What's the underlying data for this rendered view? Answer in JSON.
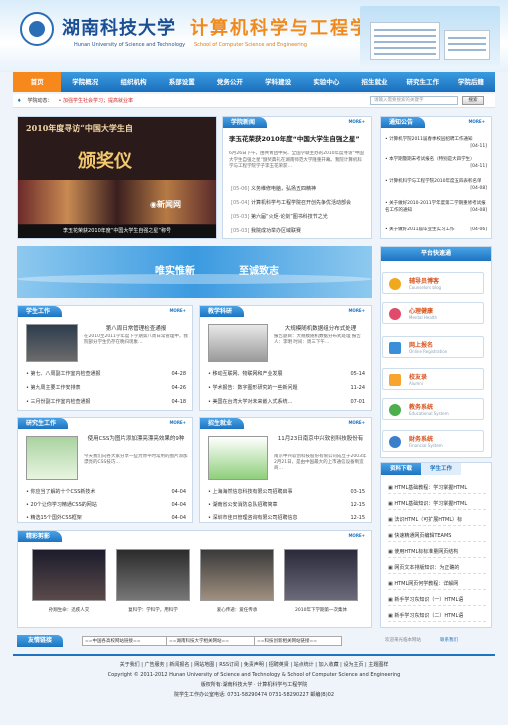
{
  "header": {
    "school_cn": "湖南科技大学",
    "college_cn": "计算机科学与工程学院",
    "school_en": "Hunan University of Science and Technology",
    "college_en": "School of Computer Science and Engineering"
  },
  "nav": {
    "items": [
      "首页",
      "学院概况",
      "组织机构",
      "系部设置",
      "党务公开",
      "学科建设",
      "实验中心",
      "招生就业",
      "研究生工作",
      "学院后籍"
    ]
  },
  "subbar": {
    "label": "学院动态：",
    "marquee": "• 加强学生社会学习；提高就业率",
    "search_placeholder": "请输入需要搜索的关键字",
    "search_button": "搜索"
  },
  "focus": {
    "banner_text": "2010年度寻访“中国大学生自",
    "caption": "李玉花荣获2010年度“中国大学生自强之星”称号",
    "award_text": "颁奖仪"
  },
  "news": {
    "title": "学院新闻",
    "more": "MORE+",
    "headline": "李玉花荣获2010年度“中国大学生自强之星”",
    "summary": "6月26日下午，由共青团中央、全国学联主办的2010年度寻访“中国大学生自强之星”颁奖典礼在湖南师范大学隆重开幕。我院计算机科学与工程学院学子李玉花荣获…",
    "items": [
      {
        "date": "[05-06]",
        "text": "义务维修电脑，弘扬五四精神"
      },
      {
        "date": "[05-04]",
        "text": "计算机科学与工程学院召开创先争优活动部会"
      },
      {
        "date": "[05-03]",
        "text": "第六届“火炬·论剑”图书科技节之光"
      },
      {
        "date": "[05-03]",
        "text": "我院成功举办区域联赛"
      }
    ]
  },
  "notices": {
    "title": "通知公告",
    "more": "MORE+",
    "items": [
      {
        "text": "• 计算机学院2011届春季校园招聘工作通知",
        "date": "[04-11]"
      },
      {
        "text": "• 本学期暨期末考试报名（特别是大四学生）",
        "date": "[04-11]"
      },
      {
        "text": "• 计算机科学与工程学院2010年度五四表彰名单",
        "date": "[04-08]"
      },
      {
        "text": "• 关于做好2010-2011学年度第二学期重修考试报名工作的通知",
        "date": "[04-08]"
      },
      {
        "text": "• 关于做好2011届毕业生实习工作",
        "date": "[04-06]"
      }
    ]
  },
  "banner": {
    "text1": "唯实惟新",
    "text2": "至诚致志"
  },
  "platform": {
    "title": "平台快速通",
    "items": [
      {
        "cn": "辅导员博客",
        "en": "Counselors blog",
        "color": "#f0a81f"
      },
      {
        "cn": "心理健康",
        "en": "Mental Health",
        "color": "#e04a6b"
      },
      {
        "cn": "网上报名",
        "en": "Online Registration",
        "color": "#3b8ed8"
      },
      {
        "cn": "校友录",
        "en": "Alumni",
        "color": "#f7a52f"
      },
      {
        "cn": "教务系统",
        "en": "Educational System",
        "color": "#4cae4c"
      },
      {
        "cn": "财务系统",
        "en": "Financial System",
        "color": "#3a7fcb"
      }
    ]
  },
  "student_work": {
    "title": "学生工作",
    "more": "MORE+",
    "feature_title": "第八周日常管理检查通报",
    "feature_text": "在2010至2011学年度下学期第八周日常管理中，我院部分学生仍存在晚归现象…",
    "items": [
      {
        "text": "• 第七、八周副工作室内检查通报",
        "date": "04-28"
      },
      {
        "text": "• 第九周主要工作安排表",
        "date": "04-26"
      },
      {
        "text": "• 三月份副工作室内检查通报",
        "date": "04-18"
      }
    ]
  },
  "teacher_research": {
    "title": "教学科研",
    "more": "MORE+",
    "feature_title": "大规模随机数据组分布式处理",
    "feature_text": "报告题目：大规模随机数据分布式处理 报告人：李明 时间：周三下午…",
    "items": [
      {
        "text": "• 移动互联网、物联网和产业发展",
        "date": "05-14"
      },
      {
        "text": "• 学术报告：数字图形研究的一些新问题",
        "date": "11-24"
      },
      {
        "text": "• 美国在台湾大学对未来嵌入式系统…",
        "date": "07-01"
      }
    ]
  },
  "grad_work": {
    "title": "研究生工作",
    "more": "MORE+",
    "feature_title": "使用CSS为图片添加漂亮漂亮效果的9种",
    "feature_text": "今天我们向各大家分享一些为你平时常用的图片添加漂亮的CSS技巧…",
    "items": [
      {
        "text": "• 你应当了解的十个CSS新技术",
        "date": "04-04"
      },
      {
        "text": "• 20个让你学习精通CSS的网站",
        "date": "04-04"
      },
      {
        "text": "• 精选15个国外CSS框架",
        "date": "04-04"
      }
    ]
  },
  "recruit": {
    "title": "招生就业",
    "more": "MORE+",
    "feature_title": "11月23日南京中兴软创科技股份有",
    "feature_text": "南京中兴软创科技股份有限公司成立于2003年2月21日，是由中国最大的上市通信设备制造商…",
    "items": [
      {
        "text": "• 上海海然信息科技有限公司招聘启事",
        "date": "03-15"
      },
      {
        "text": "• 湖南省公安消防总队招聘简章",
        "date": "12-15"
      },
      {
        "text": "• 深圳市佳日管理咨询有限公司招聘信息",
        "date": "12-15"
      }
    ]
  },
  "downloads": {
    "tab1": "资料下载",
    "tab2": "学生工作",
    "items": [
      "HTML基础教程：学习掌握HTML",
      "HTML基础知识：学习掌握HTML",
      "法识HTML（可扩展HTML）标",
      "快速精通网页编辑TEAMS",
      "使用HTML标标准量网页结构",
      "网页文本排版知识：为正确的",
      "HTML网页何学教程：详解网",
      "新手学习东知识（一）HTML语",
      "新手学习东知识（二）HTML语"
    ]
  },
  "gallery": {
    "title": "精彩剪影",
    "more": "MORE+",
    "items": [
      "孙翔生命：迅疾人交",
      "复科学：学科学，用科学",
      "爱心传递：爱任传承",
      "2010年下学期第一次集体"
    ]
  },
  "friend_links": {
    "label": "友情链接",
    "select1": "==中国各高校网站链接==",
    "select2": "==湖南科技大学相关网站==",
    "select3": "==科技创新相关网站链接==",
    "welcome": "欢迎来光临本网站",
    "contact": "联系我们"
  },
  "footer": {
    "links": [
      "关于我们",
      "广告服务",
      "新闻报名",
      "网站地图",
      "RSS订阅",
      "免责声明",
      "招聘英贤",
      "站点统计",
      "加入收藏",
      "设为主页",
      "主题图样"
    ],
    "copyright": "Copyright © 2011-2012 Hunan University of Science and Technology & School of Computer Science and Engineering",
    "owner": "版权所有:湖南科技大学 · 计算机科学与工程学院",
    "address": "院学生工作办公室电话: 0731-58290474 0731-58290227 邮编(B)02"
  }
}
